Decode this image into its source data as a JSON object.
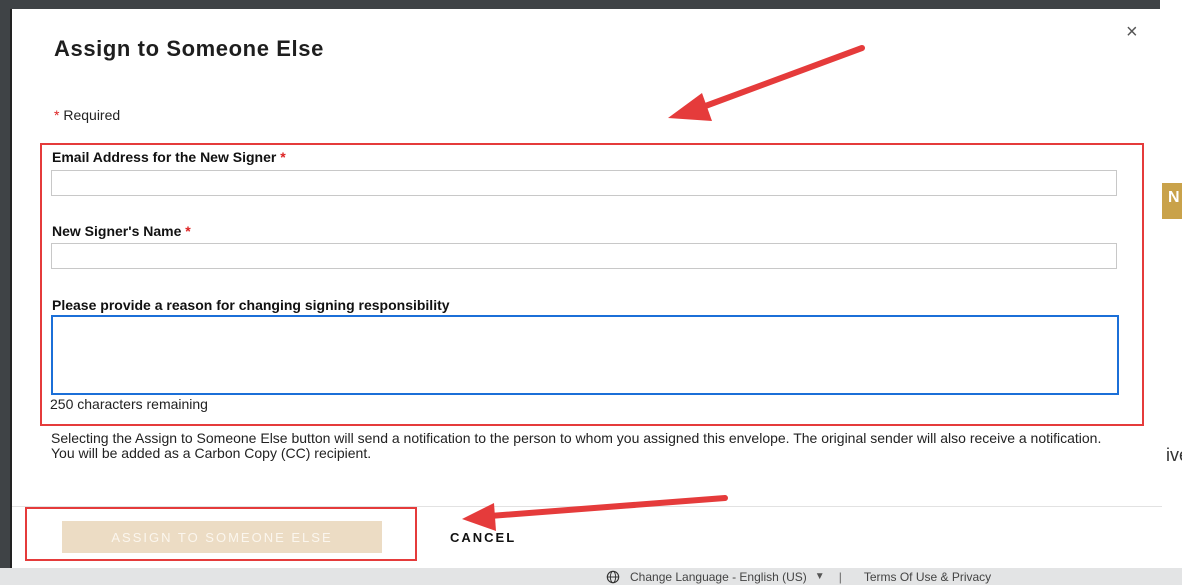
{
  "dialog": {
    "title": "Assign to Someone Else",
    "close_glyph": "×",
    "required_note": "Required",
    "required_marker": "*",
    "email_label": "Email Address for the New Signer",
    "email_value": "",
    "name_label": "New Signer's Name",
    "name_value": "",
    "reason_label": "Please provide a reason for changing signing responsibility",
    "reason_value": "",
    "chars_remaining": "250 characters remaining",
    "notice": "Selecting the Assign to Someone Else button will send a notification to the person to whom you assigned this envelope. The original sender will also receive a notification. You will be added as a Carbon Copy (CC) recipient.",
    "assign_button": "ASSIGN TO SOMEONE ELSE",
    "cancel_button": "CANCEL"
  },
  "footer": {
    "language": "Change Language - English (US)",
    "separator": "|",
    "terms": "Terms Of Use & Privacy"
  },
  "background": {
    "gold_button_fragment": "N",
    "text_fragment": "ive"
  },
  "icons": [
    "close-icon",
    "globe-icon",
    "caret-down-icon",
    "arrow-annotation"
  ],
  "colors": {
    "accent_disabled": "#ecdcc4",
    "focus_border": "#1b6fd8",
    "required_star": "#dd2222",
    "annotation": "#e53b3b",
    "background_button": "#c9a24a"
  }
}
